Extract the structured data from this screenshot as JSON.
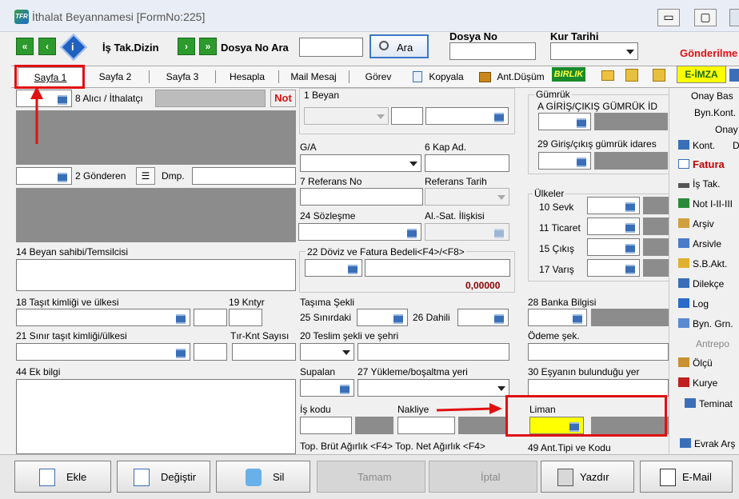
{
  "window": {
    "title": "İthalat Beyannamesi [FormNo:225]",
    "minimize": "▭",
    "maximize": "▢",
    "logo": "TFR"
  },
  "toolbar": {
    "is_tak_dizin": "İş Tak.Dizin",
    "dosya_no_ara": "Dosya No Ara",
    "ara_button": "Ara",
    "dosya_no_label": "Dosya No",
    "kur_tarihi_label": "Kur Tarihi",
    "gonderilme": "Gönderilme"
  },
  "tabs": {
    "sayfa1": "Sayfa 1",
    "sayfa2": "Sayfa 2",
    "sayfa3": "Sayfa 3",
    "hesapla": "Hesapla",
    "mail": "Mail Mesaj",
    "gorev": "Görev",
    "kopyala": "Kopyala",
    "antdusum": "Ant.Düşüm",
    "birlik": "BIRLIK",
    "eimza": "E-İMZA"
  },
  "fields": {
    "alici": "8 Alıcı / İthalatçı",
    "not": "Not",
    "gonderen": "2 Gönderen",
    "dmp": "Dmp.",
    "beyan_sahibi": "14 Beyan sahibi/Temsilcisi",
    "tasit": "18 Taşıt kimliği ve ülkesi",
    "kntyr": "19 Kntyr",
    "sinir_tasit": "21 Sınır taşıt kimliği/ülkesi",
    "tir_knt": "Tır-Knt Sayısı",
    "ek_bilgi": "44 Ek bilgi",
    "beyan": "1 Beyan",
    "ga": "G/A",
    "kap_ad": "6 Kap Ad.",
    "referans_no": "7 Referans No",
    "referans_tarih": "Referans Tarih",
    "sozlesme": "24 Sözleşme",
    "al_sat": "Al.-Sat. İlişkisi",
    "doviz": "22 Döviz ve Fatura Bedeli<F4>/<F8>",
    "doviz_value": "0,00000",
    "tasima": "Taşıma Şekli",
    "sinirdaki": "25 Sınırdaki",
    "dahili": "26 Dahili",
    "teslim": "20 Teslim şekli ve şehri",
    "supalan": "Supalan",
    "yukleme": "27 Yükleme/boşaltma yeri",
    "is_kodu": "İş kodu",
    "nakliye": "Nakliye",
    "top_brut": "Top. Brüt Ağırlık <F4> Top. Net Ağırlık <F4>",
    "gumruk": "Gümrük",
    "giris_cikis": "A GİRİŞ/ÇIKIŞ GÜMRÜK İD",
    "giris_cikis_idare": "29 Giriş/çıkış gümrük idares",
    "ulkeler": "Ülkeler",
    "sevk": "10 Sevk",
    "ticaret": "11 Ticaret",
    "cikis": "15 Çıkış",
    "varis": "17 Varış",
    "banka": "28 Banka Bilgisi",
    "odeme": "Ödeme şek.",
    "esya_yer": "30 Eşyanın bulunduğu yer",
    "liman": "Liman",
    "ant_tipi": "49 Ant.Tipi ve Kodu"
  },
  "side_menu": {
    "onay_bas": "Onay Bas",
    "byn_kont": "Byn.Kont.",
    "onay": "Onay",
    "kont": "Kont.",
    "kont_d": "D",
    "fatura": "Fatura",
    "is_tak": "İş Tak.",
    "not_iii": "Not I-II-III",
    "arsiv": "Arşiv",
    "arsivle": "Arsivle",
    "sb_akt": "S.B.Akt.",
    "dilekce": "Dilekçe",
    "log": "Log",
    "byn_grn": "Byn. Grn.",
    "antrepo": "Antrepo",
    "olcu": "Ölçü",
    "kurye": "Kurye",
    "teminat": "Teminat",
    "evrak": "Evrak Arş"
  },
  "buttons": {
    "ekle": "Ekle",
    "degistir": "Değiştir",
    "sil": "Sil",
    "tamam": "Tamam",
    "iptal": "İptal",
    "yazdir": "Yazdır",
    "email": "E-Mail"
  },
  "colors": {
    "highlight": "#e01010",
    "liman_field": "#ffff00",
    "fatura": "#c00000"
  }
}
